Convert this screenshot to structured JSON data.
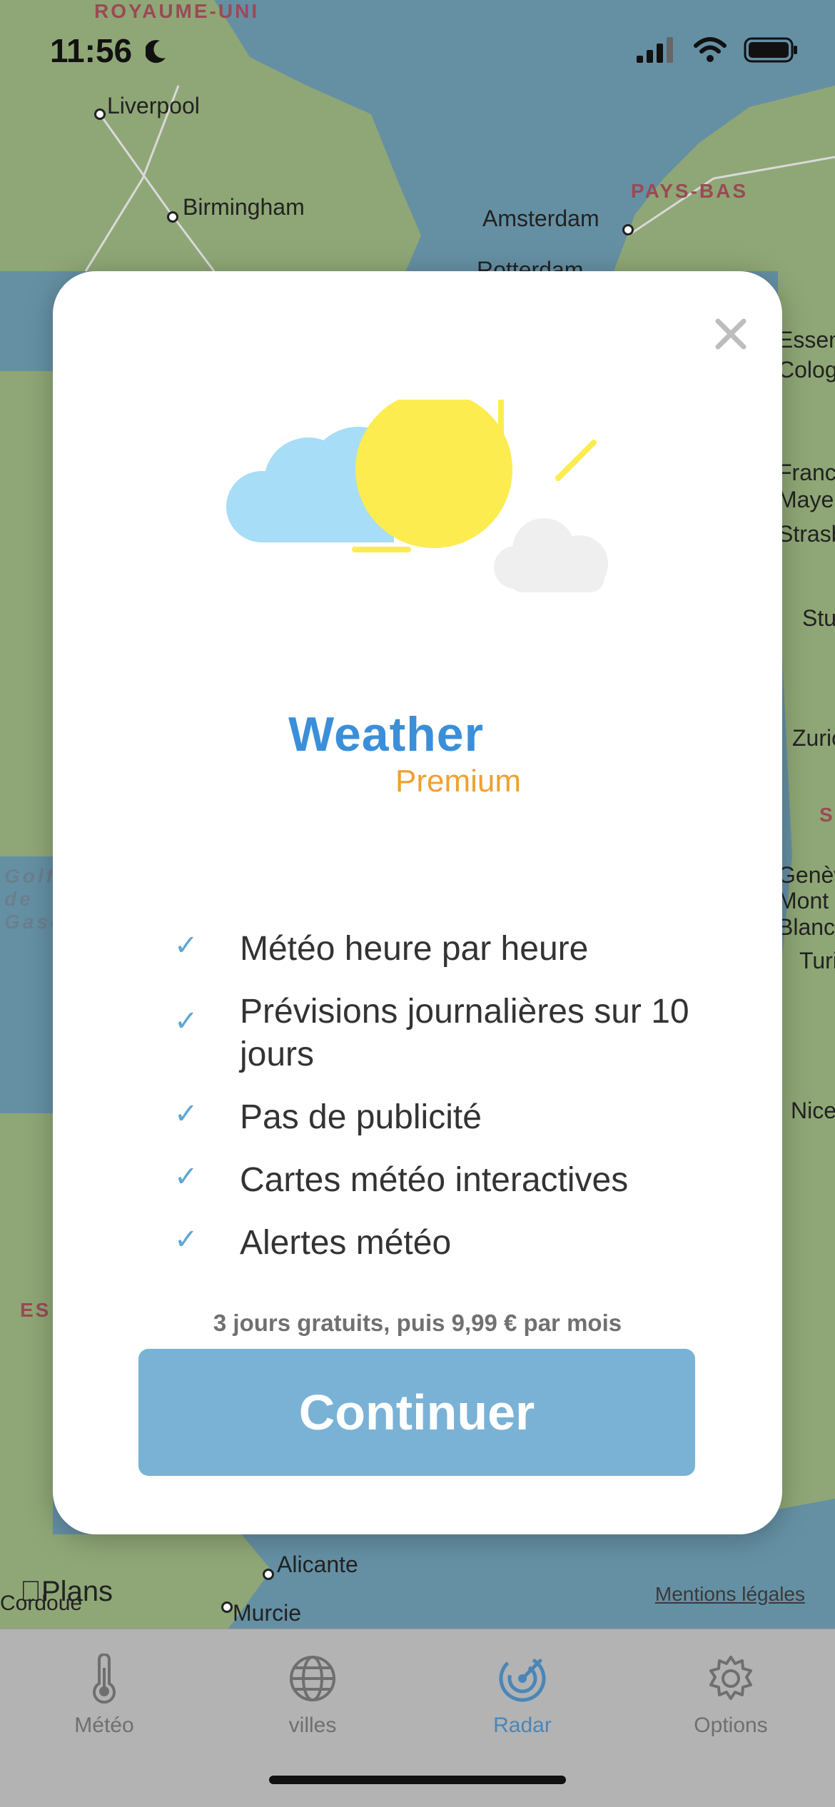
{
  "status_bar": {
    "time": "11:56",
    "icons": [
      "moon-icon",
      "signal-icon",
      "wifi-icon",
      "battery-icon"
    ]
  },
  "map": {
    "countries": [
      "ROYAUME-UNI",
      "PAYS-BAS",
      "ES",
      "S"
    ],
    "cities": [
      "Liverpool",
      "Birmingham",
      "Amsterdam",
      "Rotterdam",
      "Essen",
      "Cologne",
      "Francfort",
      "Mayence",
      "Strasbourg",
      "Stuttgart",
      "Zurich",
      "Genève",
      "Mont Blanc",
      "Turin",
      "Nice",
      "Alicante",
      "Murcie",
      "Cordoue"
    ],
    "sea": "Golfe de Gascogne",
    "attribution": "Plans",
    "legal_link": "Mentions légales"
  },
  "modal": {
    "brand_name": "Weather",
    "brand_sub": "Premium",
    "features": [
      "Météo heure par heure",
      "Prévisions journalières sur 10 jours",
      "Pas de publicité",
      "Cartes météo interactives",
      "Alertes météo"
    ],
    "price_text": "3 jours gratuits, puis 9,99 € par mois",
    "cta_label": "Continuer",
    "close_icon": "close-icon"
  },
  "tabs": [
    {
      "label": "Météo",
      "icon": "thermometer-icon"
    },
    {
      "label": "villes",
      "icon": "globe-icon"
    },
    {
      "label": "Radar",
      "icon": "radar-icon",
      "active": true
    },
    {
      "label": "Options",
      "icon": "gear-icon"
    }
  ],
  "colors": {
    "accent": "#4a86b8",
    "cta": "#7ab2d6",
    "brand_blue": "#3b8fd9",
    "brand_orange": "#f0a030",
    "sun": "#fcec50",
    "cloud": "#a7ddf6",
    "sea": "#6290a6",
    "land": "#8fa776"
  }
}
